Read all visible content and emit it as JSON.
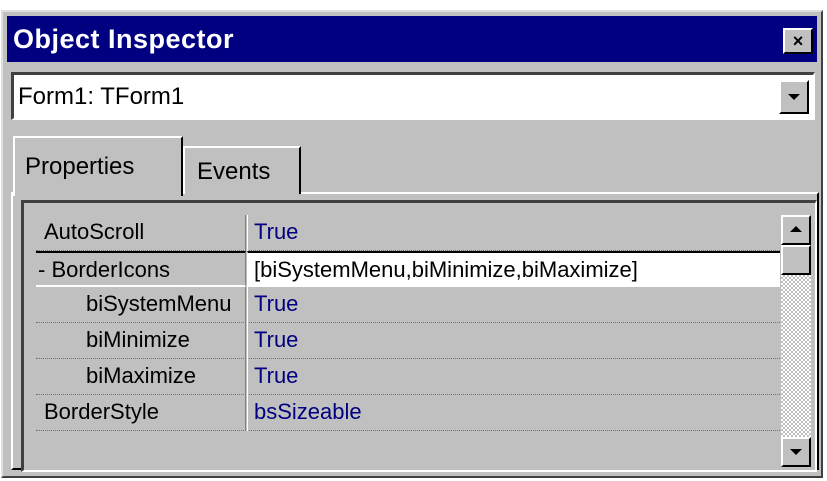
{
  "window": {
    "title": "Object Inspector",
    "close_symbol": "×",
    "close_icon": "close-icon"
  },
  "object_selector": {
    "value": "Form1: TForm1",
    "icon": "chevron-down-icon"
  },
  "tabs": [
    {
      "label": "Properties",
      "active": true
    },
    {
      "label": "Events",
      "active": false
    }
  ],
  "properties": [
    {
      "name": "AutoScroll",
      "value": "True"
    },
    {
      "name": "- BorderIcons",
      "value": "[biSystemMenu,biMinimize,biMaximize]",
      "selected": true
    },
    {
      "name": "biSystemMenu",
      "value": "True",
      "sub": true
    },
    {
      "name": "biMinimize",
      "value": "True",
      "sub": true
    },
    {
      "name": "biMaximize",
      "value": "True",
      "sub": true
    },
    {
      "name": "BorderStyle",
      "value": "bsSizeable"
    }
  ],
  "scrollbar": {
    "up_icon": "scroll-up-icon",
    "down_icon": "scroll-down-icon",
    "position": 0.0
  },
  "colors": {
    "titlebar": "#000080",
    "face": "#c0c0c0",
    "value_text": "#000080"
  }
}
